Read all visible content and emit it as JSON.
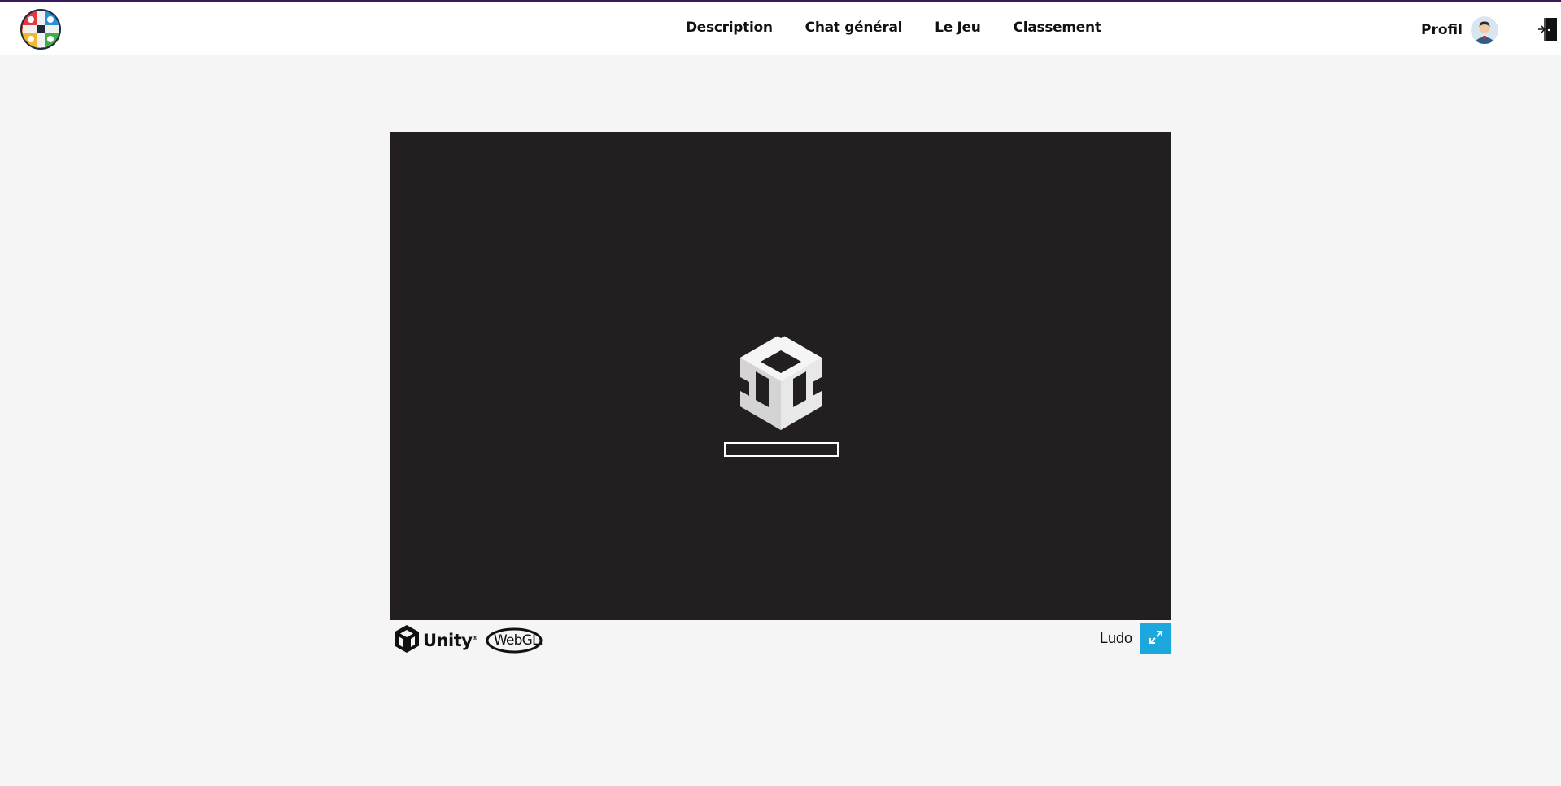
{
  "navbar": {
    "logo_icon": "ludo-board-logo",
    "links": [
      {
        "label": "Description"
      },
      {
        "label": "Chat général"
      },
      {
        "label": "Le Jeu"
      },
      {
        "label": "Classement"
      }
    ],
    "profile_label": "Profil",
    "avatar_icon": "user-avatar-icon",
    "logout_icon": "logout-door-icon"
  },
  "game": {
    "loading_logo_icon": "unity-cube-logo",
    "loading_progress": 0.0
  },
  "footer": {
    "unity_label": "Unity",
    "unity_tm": "®",
    "webgl_label": "WebGL",
    "webgl_dot": ".",
    "game_title": "Ludo",
    "fullscreen_icon": "fullscreen-expand-icon"
  },
  "colors": {
    "accent": "#1ca8dd",
    "canvas_bg": "#231f20",
    "page_bg": "#f5f5f5",
    "topline": "#3a1a5a"
  }
}
